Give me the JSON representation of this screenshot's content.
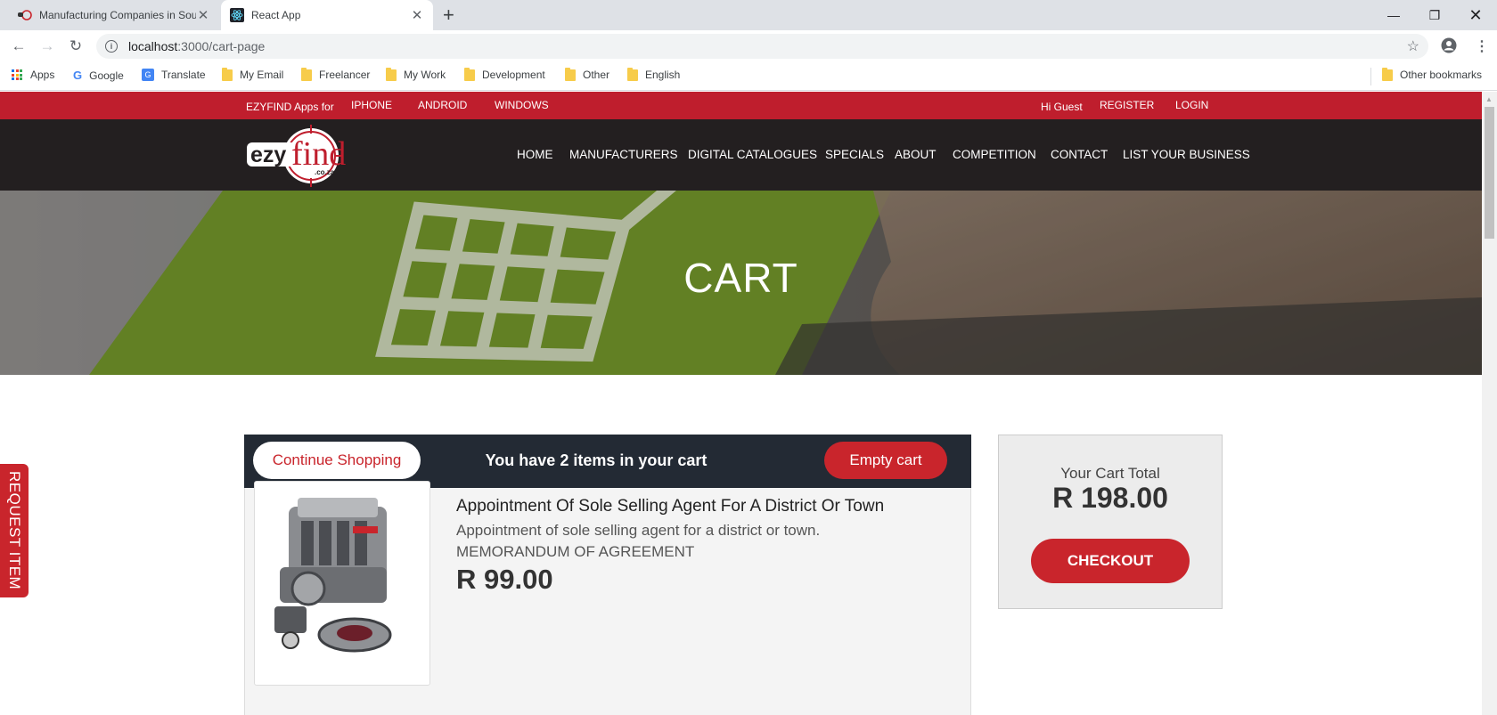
{
  "browser": {
    "tabs": [
      {
        "title": "Manufacturing Companies in Sou",
        "active": false
      },
      {
        "title": "React App",
        "active": true
      }
    ],
    "url_host": "localhost",
    "url_path": ":3000/cart-page",
    "bookmarks": [
      "Apps",
      "Google",
      "Translate",
      "My Email",
      "Freelancer",
      "My Work",
      "Development",
      "Other",
      "English"
    ],
    "other_bookmarks": "Other bookmarks"
  },
  "topbar": {
    "apps_label": "EZYFIND Apps for",
    "platforms": [
      "IPHONE",
      "ANDROID",
      "WINDOWS"
    ],
    "greeting": "Hi Guest",
    "register": "REGISTER",
    "login": "LOGIN"
  },
  "nav": {
    "logo_main": "ezy",
    "logo_accent": "find",
    "logo_domain": ".co.za",
    "links": [
      "HOME",
      "MANUFACTURERS",
      "DIGITAL CATALOGUES",
      "SPECIALS",
      "ABOUT",
      "COMPETITION",
      "CONTACT",
      "LIST YOUR BUSINESS"
    ]
  },
  "hero": {
    "title": "CART"
  },
  "cart": {
    "continue_label": "Continue Shopping",
    "count_text": "You have 2 items in your cart",
    "empty_label": "Empty cart",
    "item": {
      "title": "Appointment Of Sole Selling Agent For A District Or Town",
      "desc_line1": "Appointment of sole selling agent for a district or town.",
      "desc_line2": "MEMORANDUM OF AGREEMENT",
      "price": "R 99.00"
    }
  },
  "summary": {
    "label": "Your Cart Total",
    "total": "R 198.00",
    "checkout": "CHECKOUT"
  },
  "request_tab": "REQUEST ITEM",
  "colors": {
    "brand_red": "#bf1e2d",
    "button_red": "#c9252c",
    "nav_dark": "#231f20",
    "cart_header": "#232a34"
  }
}
